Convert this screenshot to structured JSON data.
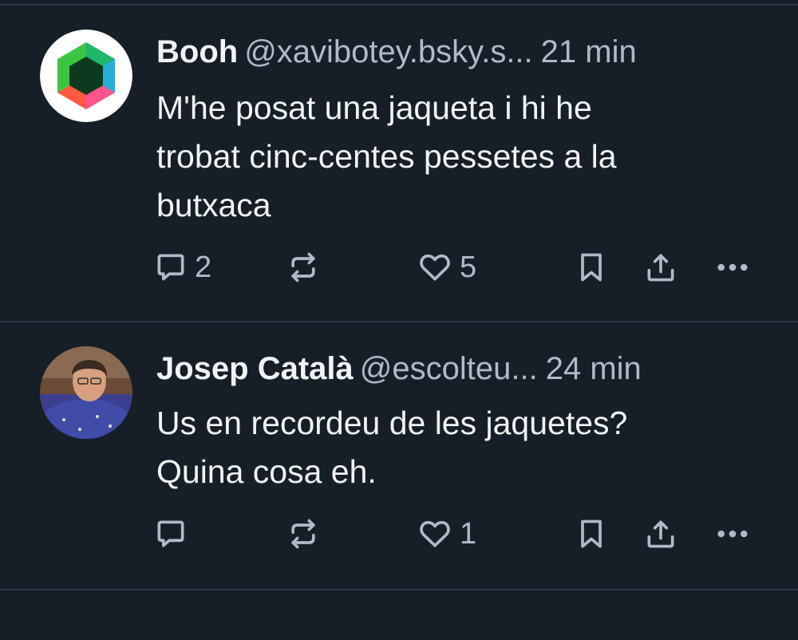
{
  "colors": {
    "background": "#161e27",
    "divider": "#2e3a48",
    "text": "#f1f3f5",
    "muted": "#aebbc9"
  },
  "posts": [
    {
      "author": "Booh",
      "handle": "@xavibotey.bsky.s...",
      "time": "21 min",
      "text": "M'he posat una jaqueta i hi he\ntrobat cinc-centes pessetes a la\nbutxaca",
      "avatar": "hexagon-logo",
      "reply_count": "2",
      "repost_count": "",
      "like_count": "5"
    },
    {
      "author": "Josep Català",
      "handle": "@escolteu...",
      "time": "24 min",
      "text": "Us en recordeu de les jaquetes?\nQuina cosa eh.",
      "avatar": "person-photo",
      "reply_count": "",
      "repost_count": "",
      "like_count": "1"
    }
  ]
}
